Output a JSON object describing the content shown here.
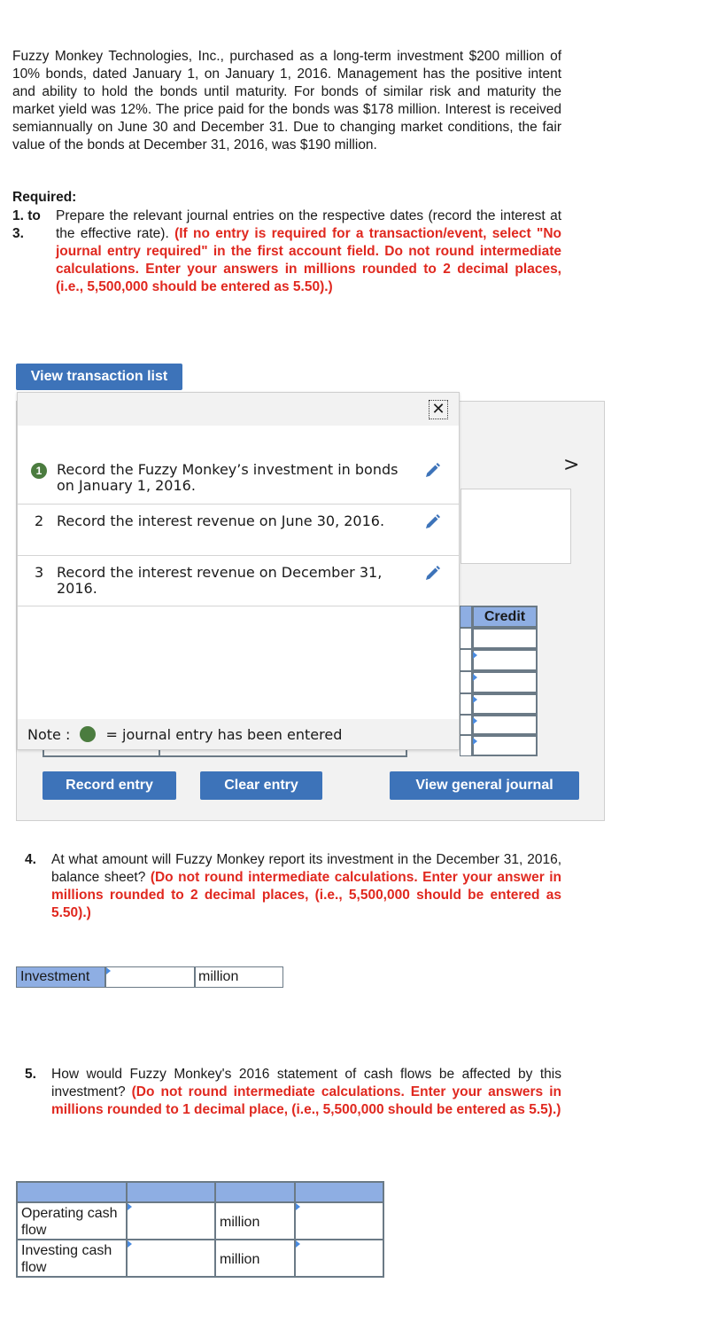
{
  "problem": {
    "paragraph": "Fuzzy Monkey Technologies, Inc., purchased as a long-term investment $200 million of 10% bonds, dated January 1, on January 1, 2016. Management has the positive intent and ability to hold the bonds until maturity. For bonds of similar risk and maturity the market yield was 12%. The price paid for the bonds was $178 million. Interest is received semiannually on June 30 and December 31. Due to changing market conditions, the fair value of the bonds at December 31, 2016, was $190 million."
  },
  "required": {
    "title": "Required:",
    "number": "1. to 3.",
    "text": "Prepare the relevant journal entries on the respective dates (record the interest at the effective rate).",
    "instruction": "(If no entry is required for a transaction/event, select \"No journal entry required\" in the first account field. Do not round intermediate calculations. Enter your answers in millions rounded to 2 decimal places, (i.e., 5,500,000 should be entered as 5.50).)"
  },
  "buttons": {
    "view_transaction_list": "View transaction list",
    "record_entry": "Record entry",
    "clear_entry": "Clear entry",
    "view_general_journal": "View general journal"
  },
  "popup": {
    "close_glyph": "✕",
    "items": [
      {
        "num": "1",
        "label": "Record the Fuzzy Monkey’s investment in bonds on January 1, 2016.",
        "entered": true
      },
      {
        "num": "2",
        "label": "Record the interest revenue on June 30, 2016.",
        "entered": false
      },
      {
        "num": "3",
        "label": "Record the interest revenue on December 31, 2016.",
        "entered": false
      }
    ],
    "note_prefix": "Note :",
    "note_suffix": "= journal entry has been entered"
  },
  "journal": {
    "next_glyph": ">",
    "credit_header": "Credit"
  },
  "q4": {
    "number": "4.",
    "text": "At what amount will Fuzzy Monkey report its investment in the December 31, 2016, balance sheet?",
    "instruction": "(Do not round intermediate calculations. Enter your answer in millions rounded to 2 decimal places, (i.e., 5,500,000 should be entered as 5.50).)",
    "label": "Investment",
    "value": "",
    "unit": "million"
  },
  "q5": {
    "number": "5.",
    "text": "How would Fuzzy Monkey's 2016 statement of cash flows be affected by this investment?",
    "instruction": "(Do not round intermediate calculations. Enter your answers in millions rounded to 1 decimal place, (i.e., 5,500,000 should be entered as 5.5).)",
    "rows": [
      {
        "label": "Operating cash flow",
        "unit": "million"
      },
      {
        "label": "Investing cash flow",
        "unit": "million"
      }
    ]
  },
  "colors": {
    "accent": "#3d73b9",
    "instruction_red": "#e0281f",
    "entered_green": "#4b7c3f",
    "header_blue": "#8eaee3"
  },
  "icons": {
    "edit": "pencil-icon",
    "close": "close-icon",
    "next": "chevron-right-icon",
    "entered": "check-circle-icon"
  }
}
